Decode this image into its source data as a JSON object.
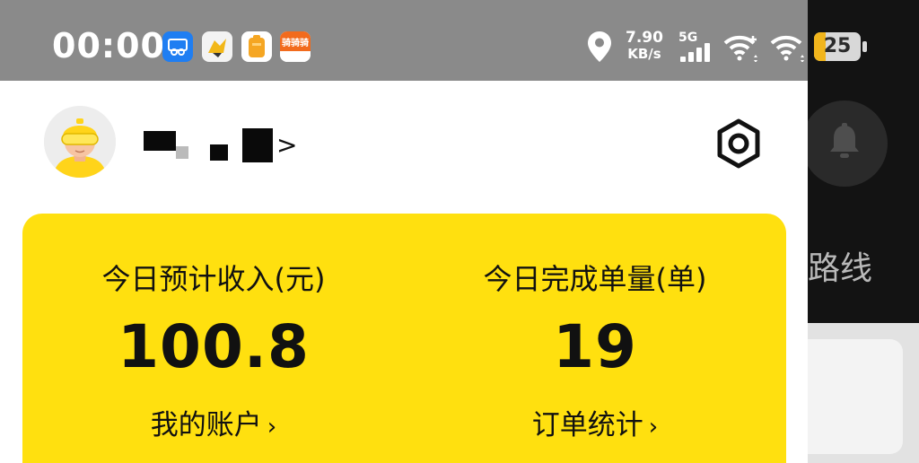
{
  "status_bar": {
    "time": "00:00",
    "speed_value": "7.90",
    "speed_unit": "KB/s",
    "network": "5G",
    "battery": "25",
    "battery_level": 0.25,
    "app_icons": [
      "screenshot-app-icon",
      "bird-app-icon",
      "orange-app-icon",
      "delivery-app-icon"
    ],
    "delivery_icon_text": "骑骑骑"
  },
  "profile": {
    "chevron": ">"
  },
  "stats": {
    "income_label": "今日预计收入(元)",
    "income_value": "100.8",
    "income_link": "我的账户",
    "orders_label": "今日完成单量(单)",
    "orders_value": "19",
    "orders_link": "订单统计",
    "link_chevron": "›"
  },
  "background": {
    "route_text": "路线"
  },
  "colors": {
    "status_bar_bg": "#8a8a8a",
    "card_yellow": "#ffe00f",
    "battery_fill": "#f1b51c"
  }
}
